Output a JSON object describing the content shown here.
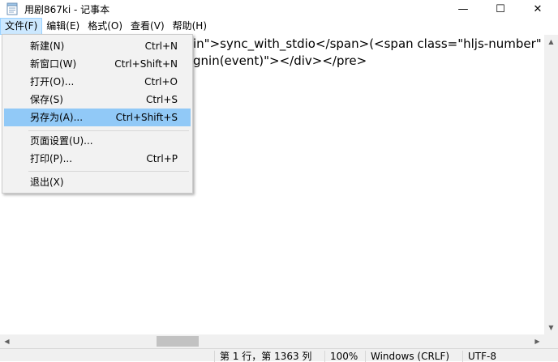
{
  "window": {
    "title": "用剧867ki - 记事本",
    "minimize_glyph": "—",
    "maximize_glyph": "☐",
    "close_glyph": "✕"
  },
  "menubar": [
    "文件(F)",
    "编辑(E)",
    "格式(O)",
    "查看(V)",
    "帮助(H)"
  ],
  "file_menu": {
    "items": [
      {
        "label": "新建(N)",
        "shortcut": "Ctrl+N"
      },
      {
        "label": "新窗口(W)",
        "shortcut": "Ctrl+Shift+N"
      },
      {
        "label": "打开(O)...",
        "shortcut": "Ctrl+O"
      },
      {
        "label": "保存(S)",
        "shortcut": "Ctrl+S"
      },
      {
        "label": "另存为(A)...",
        "shortcut": "Ctrl+Shift+S"
      },
      {
        "label": "页面设置(U)...",
        "shortcut": ""
      },
      {
        "label": "打印(P)...",
        "shortcut": "Ctrl+P"
      },
      {
        "label": "退出(X)",
        "shortcut": ""
      }
    ],
    "highlighted_item": "另存为(A)..."
  },
  "editor": {
    "line1": "in\">sync_with_stdio</span>(<span class=\"hljs-number\"",
    "line2": "gnin(event)\"></div></pre>"
  },
  "statusbar": {
    "position": "第 1 行，第 1363 列",
    "zoom": "100%",
    "line_ending": "Windows (CRLF)",
    "encoding": "UTF-8"
  },
  "colors": {
    "menu_highlight": "#91c9f7",
    "menubar_active": "#cce8ff"
  }
}
